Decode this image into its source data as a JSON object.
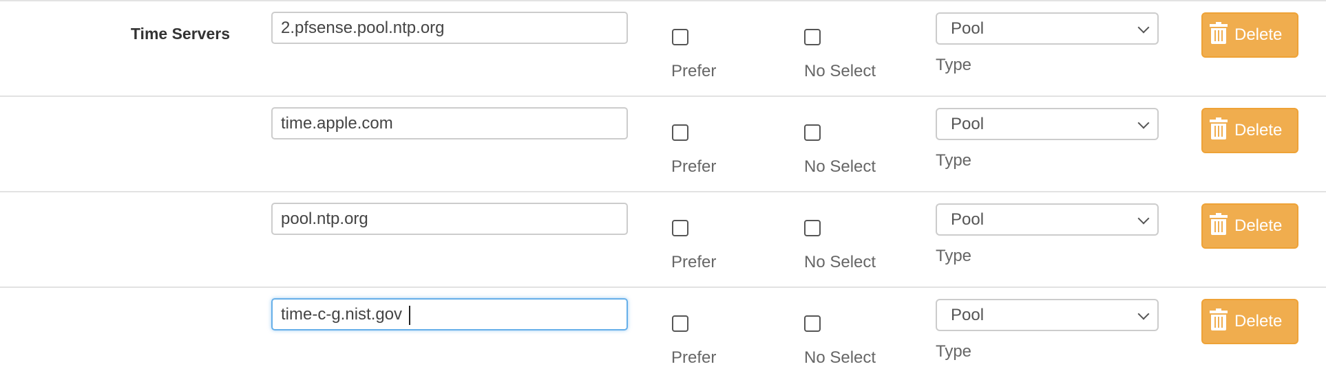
{
  "section_label": "Time Servers",
  "prefer_label": "Prefer",
  "noselect_label": "No Select",
  "type_label": "Type",
  "delete_label": "Delete",
  "accent_color": "#f0ad4e",
  "servers": [
    {
      "address": "2.pfsense.pool.ntp.org",
      "prefer": false,
      "noselect": false,
      "type": "Pool"
    },
    {
      "address": "time.apple.com",
      "prefer": false,
      "noselect": false,
      "type": "Pool"
    },
    {
      "address": "pool.ntp.org",
      "prefer": false,
      "noselect": false,
      "type": "Pool"
    },
    {
      "address": "time-c-g.nist.gov",
      "prefer": false,
      "noselect": false,
      "type": "Pool",
      "focused": true
    }
  ]
}
